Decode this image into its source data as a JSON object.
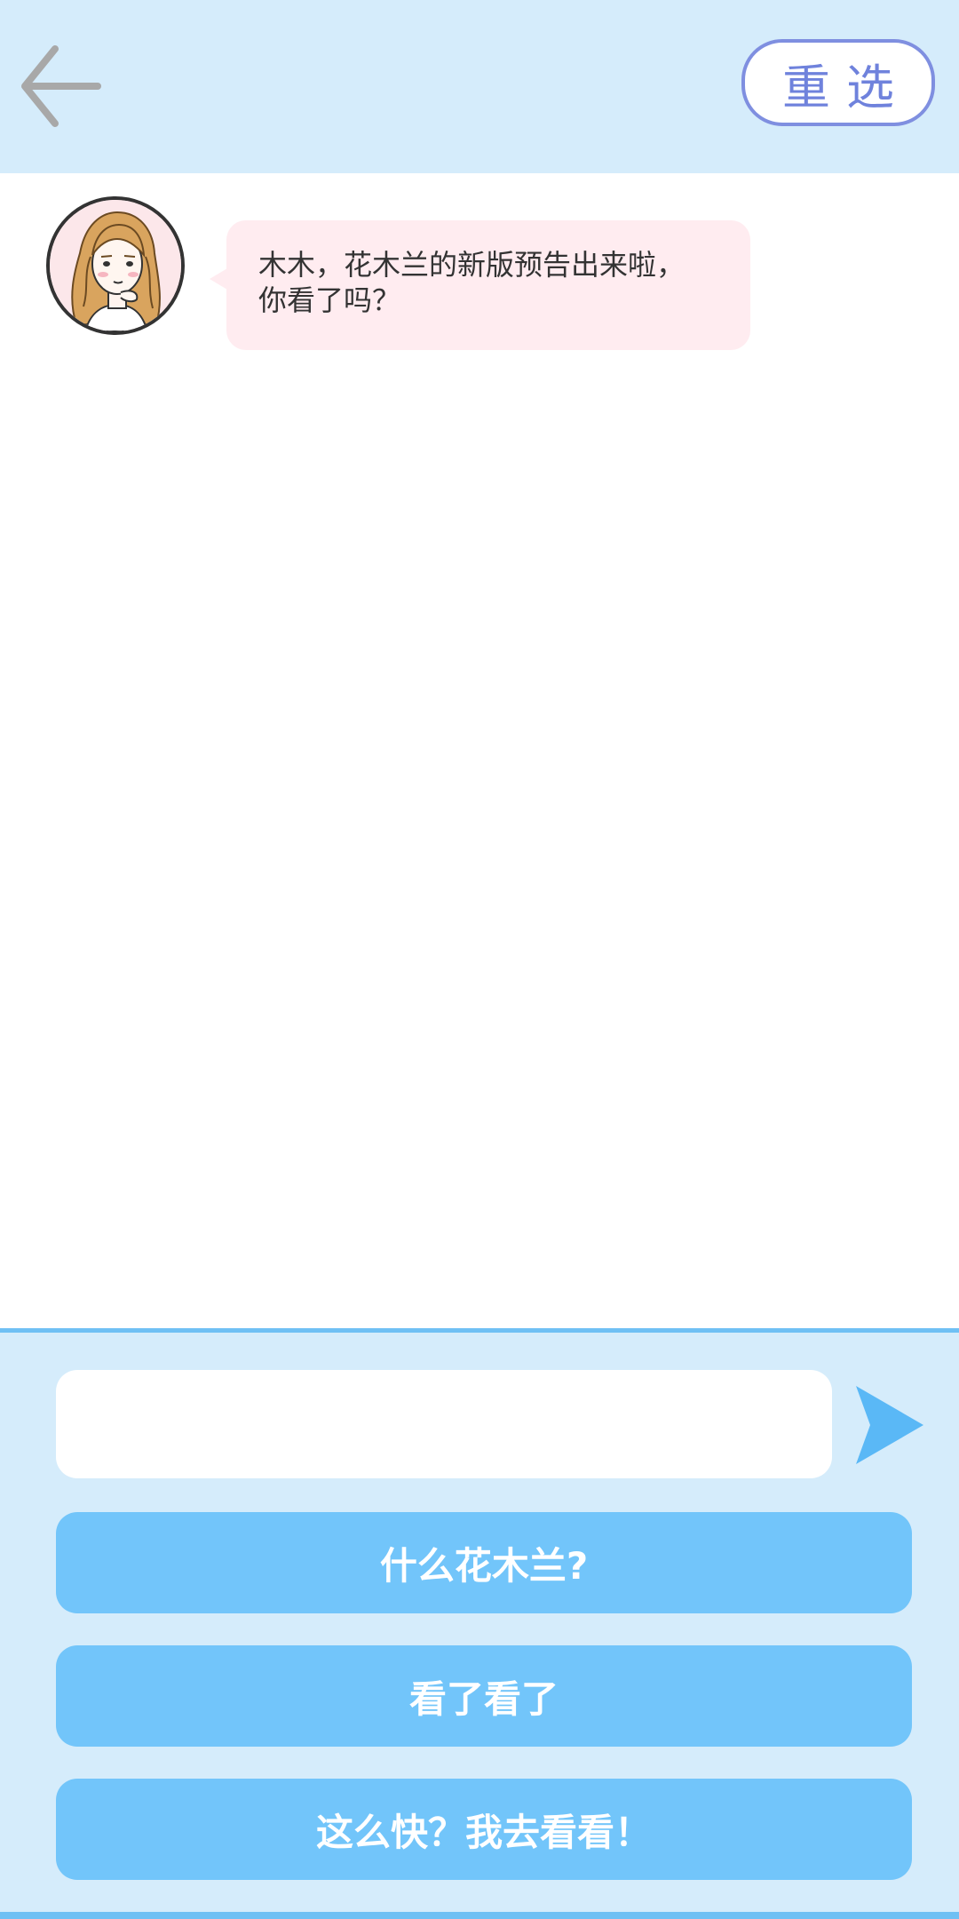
{
  "header": {
    "back_icon": "arrow-left-icon",
    "reselect_label": "重选"
  },
  "chat": {
    "messages": [
      {
        "sender_avatar": "girl-avatar",
        "line1": "木木，花木兰的新版预告出来啦，",
        "line2": "你看了吗？"
      }
    ]
  },
  "composer": {
    "input_value": "",
    "send_icon": "paper-plane-icon"
  },
  "options": [
    {
      "label": "什么花木兰?"
    },
    {
      "label": "看了看了"
    },
    {
      "label": "这么快？我去看看！"
    }
  ],
  "colors": {
    "header_bg": "#d5ecfb",
    "accent_blue": "#72c5fa",
    "bubble_pink": "#ffecf0",
    "reselect_purple": "#7f8fe0"
  }
}
